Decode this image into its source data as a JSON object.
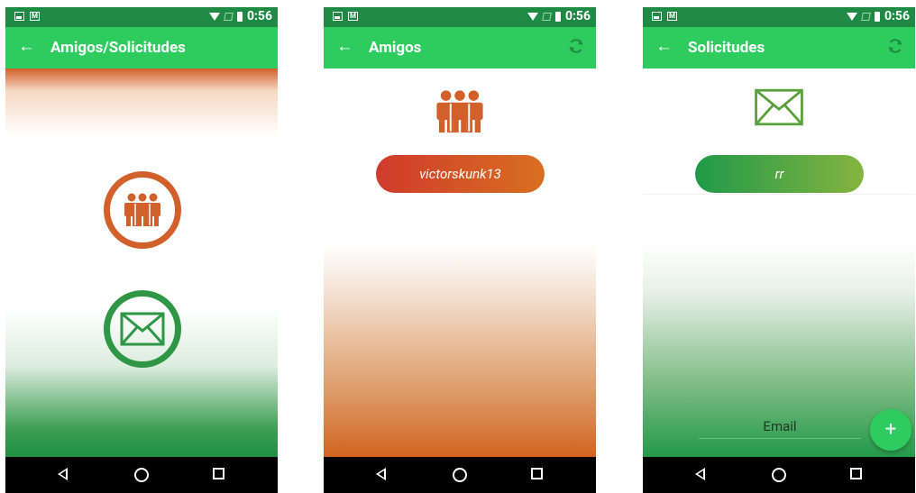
{
  "status": {
    "time": "0:56"
  },
  "colors": {
    "status_bar": "#1e8a44",
    "app_bar": "#2ecc5f",
    "friends_accent": "#d2602a",
    "requests_accent": "#2e9645",
    "nav_bar": "#000000"
  },
  "screens": [
    {
      "title": "Amigos/Solicitudes",
      "back_icon": "arrow-left-icon",
      "buttons": [
        {
          "icon": "group-people-icon"
        },
        {
          "icon": "envelope-icon"
        }
      ]
    },
    {
      "title": "Amigos",
      "back_icon": "arrow-left-icon",
      "refresh_icon": "refresh-icon",
      "icon": "group-people-icon",
      "friends": [
        "victorskunk13"
      ]
    },
    {
      "title": "Solicitudes",
      "back_icon": "arrow-left-icon",
      "refresh_icon": "refresh-icon",
      "icon": "envelope-icon",
      "requests": [
        "rr"
      ],
      "email_placeholder": "Email",
      "fab_label": "+"
    }
  ],
  "nav_icons": [
    "back-triangle-icon",
    "home-circle-icon",
    "recents-square-icon"
  ]
}
